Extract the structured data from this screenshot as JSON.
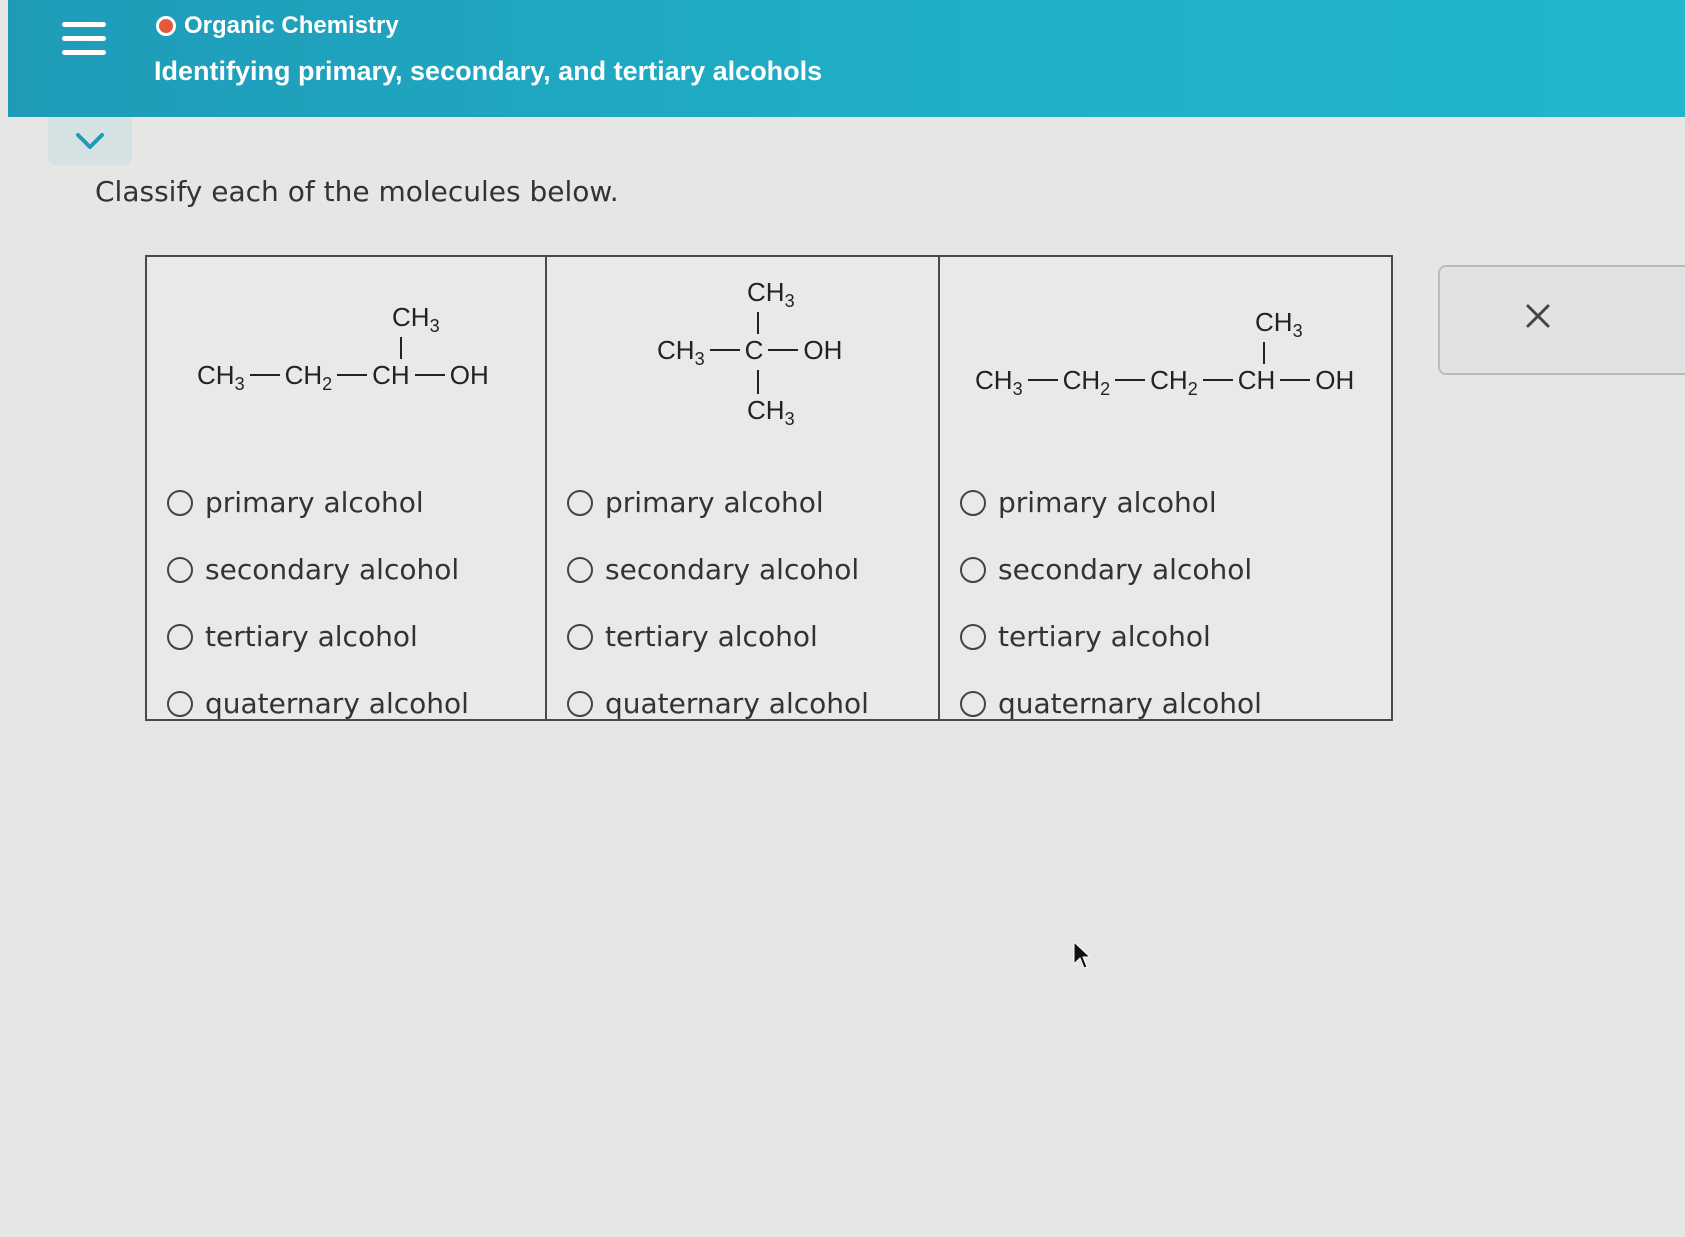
{
  "header": {
    "course": "Organic Chemistry",
    "topic": "Identifying primary, secondary, and tertiary alcohols"
  },
  "prompt": "Classify each of the molecules below.",
  "molecules": [
    {
      "branch": "CH3",
      "chain": [
        "CH3",
        "CH2",
        "CH",
        "OH"
      ]
    },
    {
      "top": "CH3",
      "chain": [
        "CH3",
        "C",
        "OH"
      ],
      "bottom": "CH3"
    },
    {
      "branch": "CH3",
      "chain": [
        "CH3",
        "CH2",
        "CH2",
        "CH",
        "OH"
      ]
    }
  ],
  "options": [
    "primary alcohol",
    "secondary alcohol",
    "tertiary alcohol",
    "quaternary alcohol"
  ],
  "colors": {
    "header": "#1fa8c2",
    "status_dot": "#e8573a"
  },
  "icons": [
    "menu-icon",
    "chevron-down-icon",
    "close-icon"
  ]
}
